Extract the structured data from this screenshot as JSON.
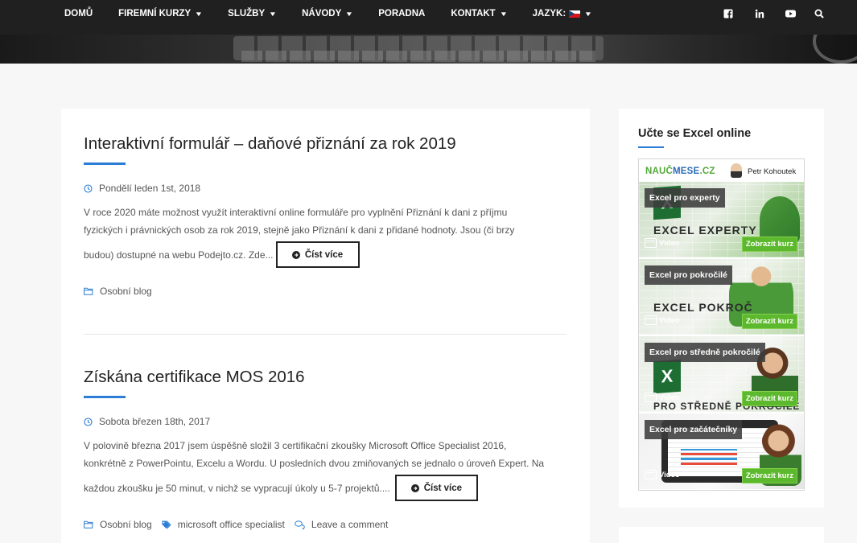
{
  "nav": {
    "items": [
      {
        "label": "DOMŮ",
        "has_dropdown": false
      },
      {
        "label": "FIREMNÍ KURZY",
        "has_dropdown": true
      },
      {
        "label": "SLUŽBY",
        "has_dropdown": true
      },
      {
        "label": "NÁVODY",
        "has_dropdown": true
      },
      {
        "label": "PORADNA",
        "has_dropdown": false
      },
      {
        "label": "KONTAKT",
        "has_dropdown": true
      }
    ],
    "language_label": "JAZYK:",
    "social_icons": [
      "facebook-icon",
      "linkedin-icon",
      "youtube-icon",
      "search-icon"
    ]
  },
  "posts": [
    {
      "title": "Interaktivní formulář – daňové přiznání za rok 2019",
      "date": "Pondělí leden 1st, 2018",
      "excerpt_lines": [
        "V roce 2020 máte možnost využít interaktivní online formuláře pro vyplnění Přiznání k dani z příjmu",
        "fyzických i právnických osob za rok 2019, stejně jako Přiznání k dani z přidané hodnoty. Jsou (či brzy",
        "budou) dostupné na webu Podejto.cz. Zde..."
      ],
      "read_more": "Číst více",
      "category": "Osobní blog"
    },
    {
      "title": "Získána certifikace MOS 2016",
      "date": "Sobota březen 18th, 2017",
      "excerpt_lines": [
        "V polovině března 2017 jsem úspěšně složil 3 certifikační zkoušky Microsoft Office Specialist 2016,",
        "konkrétně z PowerPointu, Excelu a Wordu. U posledních dvou zmiňovaných se jednalo o úroveň Expert. Na",
        "každou zkoušku je 50 minut, v nichž se vypracují úkoly u 5-7 projektů...."
      ],
      "read_more": "Číst více",
      "category": "Osobní blog",
      "tag": "microsoft office specialist",
      "comment": "Leave a comment"
    }
  ],
  "sidebar": {
    "title": "Učte se Excel online",
    "widget": {
      "logo_part1": "NAUČ",
      "logo_part2": "MESE",
      "logo_part3": ".CZ",
      "author": "Petr Kohoutek",
      "courses": [
        {
          "label": "Excel pro experty",
          "big": "EXCEL EXPERTY",
          "video": "Video",
          "button": "Zobrazit kurz"
        },
        {
          "label": "Excel pro pokročilé",
          "big": "EXCEL POKROČ",
          "video": "Video",
          "button": "Zobrazit kurz"
        },
        {
          "label": "Excel pro středně pokročilé",
          "big": "PRO STŘEDNĚ POKROČILÉ",
          "video": "Video",
          "button": "Zobrazit kurz"
        },
        {
          "label": "Excel pro začátečníky",
          "big": "",
          "video": "Video",
          "button": "Zobrazit kurz"
        }
      ]
    }
  },
  "colors": {
    "accent": "#2c7dd6",
    "topbar": "#202020",
    "button_green": "#5cb82c"
  }
}
